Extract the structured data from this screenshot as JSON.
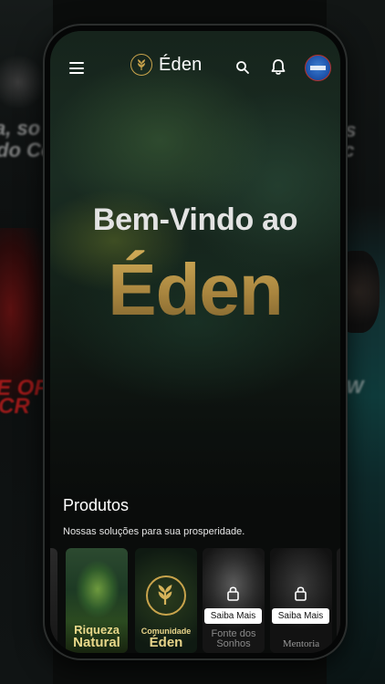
{
  "app": {
    "title": "Éden",
    "icons": {
      "menu": "menu-icon",
      "logo": "wheat-leaf-icon",
      "search": "search-icon",
      "notifications": "bell-icon",
      "lock": "lock-icon"
    }
  },
  "hero": {
    "welcome": "Bem-Vindo ao",
    "brand": "Éden"
  },
  "products": {
    "title": "Produtos",
    "subtitle": "Nossas soluções para sua prosperidade.",
    "items": [
      {
        "title_line1": "Riqueza",
        "title_line2": "Natural",
        "locked": false
      },
      {
        "title_line1": "Comunidade",
        "title_line2": "Éden",
        "locked": false
      },
      {
        "title_line1": "Fonte dos",
        "title_line2": "Sonhos",
        "locked": true,
        "button": "Saiba Mais"
      },
      {
        "title_line1": "Mentoria",
        "title_line2": "",
        "locked": true,
        "button": "Saiba Mais"
      }
    ]
  },
  "colors": {
    "accent_gold": "#c9a44c",
    "background": "#0a0c0b"
  }
}
